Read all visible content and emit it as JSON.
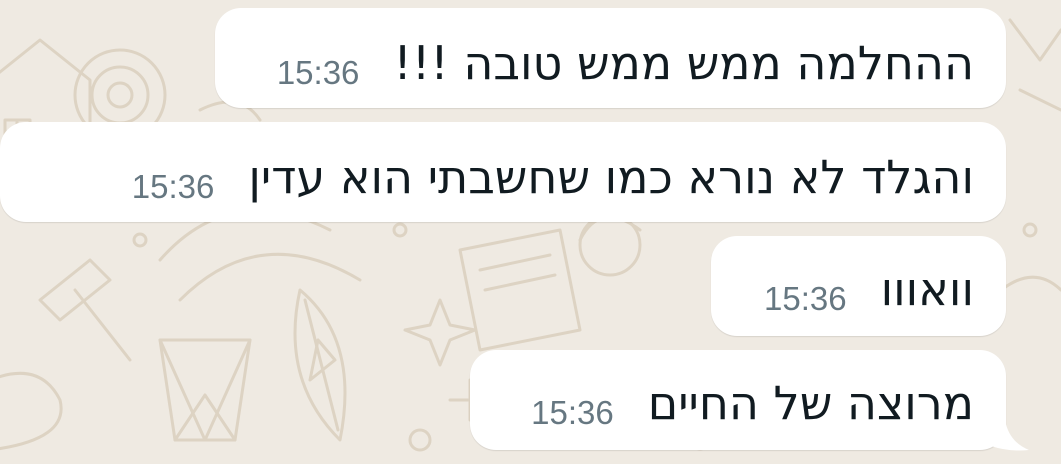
{
  "chat": {
    "messages": [
      {
        "text": "ההחלמה ממש ממש טובה !!!",
        "time": "15:36"
      },
      {
        "text": "והגלד לא נורא כמו שחשבתי הוא עדין",
        "time": "15:36"
      },
      {
        "text": "וואווו",
        "time": "15:36"
      },
      {
        "text": "מרוצה של החיים",
        "time": "15:36"
      }
    ]
  },
  "colors": {
    "chat_background": "#efeae2",
    "bubble_background": "#ffffff",
    "message_text": "#111b21",
    "timestamp_text": "#667781",
    "doodle_stroke": "#ddd3c3"
  }
}
